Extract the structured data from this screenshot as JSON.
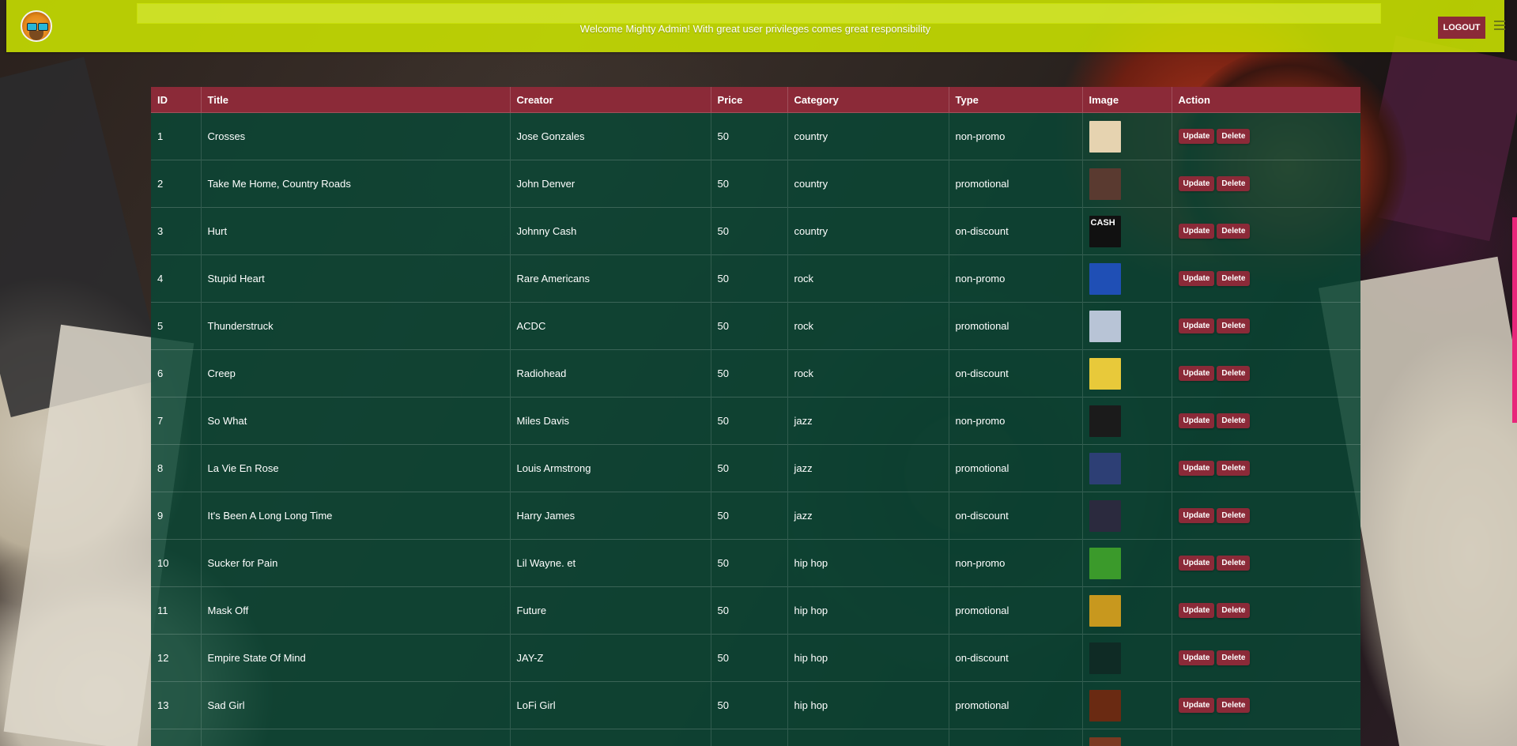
{
  "header": {
    "welcome": "Welcome Mighty Admin! With great user privileges comes great responsibility",
    "logout_label": "LOGOUT",
    "logo_icon": "lion-with-glasses-logo",
    "menu_icon": "hamburger-menu-icon"
  },
  "table": {
    "columns": [
      "ID",
      "Title",
      "Creator",
      "Price",
      "Category",
      "Type",
      "Image",
      "Action"
    ],
    "update_label": "Update",
    "delete_label": "Delete",
    "rows": [
      {
        "id": "1",
        "title": "Crosses",
        "creator": "Jose Gonzales",
        "price": "50",
        "category": "country",
        "type": "non-promo",
        "thumb": "#e6d3b0"
      },
      {
        "id": "2",
        "title": "Take Me Home, Country Roads",
        "creator": "John Denver",
        "price": "50",
        "category": "country",
        "type": "promotional",
        "thumb": "#5a3a30"
      },
      {
        "id": "3",
        "title": "Hurt",
        "creator": "Johnny Cash",
        "price": "50",
        "category": "country",
        "type": "on-discount",
        "thumb": "#111111",
        "thumb_text": "CASH"
      },
      {
        "id": "4",
        "title": "Stupid Heart",
        "creator": "Rare Americans",
        "price": "50",
        "category": "rock",
        "type": "non-promo",
        "thumb": "#1f4fb5"
      },
      {
        "id": "5",
        "title": "Thunderstruck",
        "creator": "ACDC",
        "price": "50",
        "category": "rock",
        "type": "promotional",
        "thumb": "#b8c4d6"
      },
      {
        "id": "6",
        "title": "Creep",
        "creator": "Radiohead",
        "price": "50",
        "category": "rock",
        "type": "on-discount",
        "thumb": "#e8c93a"
      },
      {
        "id": "7",
        "title": "So What",
        "creator": "Miles Davis",
        "price": "50",
        "category": "jazz",
        "type": "non-promo",
        "thumb": "#1b1b1b"
      },
      {
        "id": "8",
        "title": "La Vie En Rose",
        "creator": "Louis Armstrong",
        "price": "50",
        "category": "jazz",
        "type": "promotional",
        "thumb": "#2d3f75"
      },
      {
        "id": "9",
        "title": "It's Been A Long Long Time",
        "creator": "Harry James",
        "price": "50",
        "category": "jazz",
        "type": "on-discount",
        "thumb": "#2b2a3e"
      },
      {
        "id": "10",
        "title": "Sucker for Pain",
        "creator": "Lil Wayne. et",
        "price": "50",
        "category": "hip hop",
        "type": "non-promo",
        "thumb": "#3b9a2b"
      },
      {
        "id": "11",
        "title": "Mask Off",
        "creator": "Future",
        "price": "50",
        "category": "hip hop",
        "type": "promotional",
        "thumb": "#c8981e"
      },
      {
        "id": "12",
        "title": "Empire State Of Mind",
        "creator": "JAY-Z",
        "price": "50",
        "category": "hip hop",
        "type": "on-discount",
        "thumb": "#0f2b25"
      },
      {
        "id": "13",
        "title": "Sad Girl",
        "creator": "LoFi Girl",
        "price": "50",
        "category": "hip hop",
        "type": "promotional",
        "thumb": "#6a2a12"
      },
      {
        "id": "",
        "title": "",
        "creator": "",
        "price": "",
        "category": "",
        "type": "",
        "thumb": "#7a3a22"
      }
    ]
  },
  "colors": {
    "header_bg": "#cee800",
    "accent": "#8b2a38",
    "table_bg": "#0a4634"
  }
}
